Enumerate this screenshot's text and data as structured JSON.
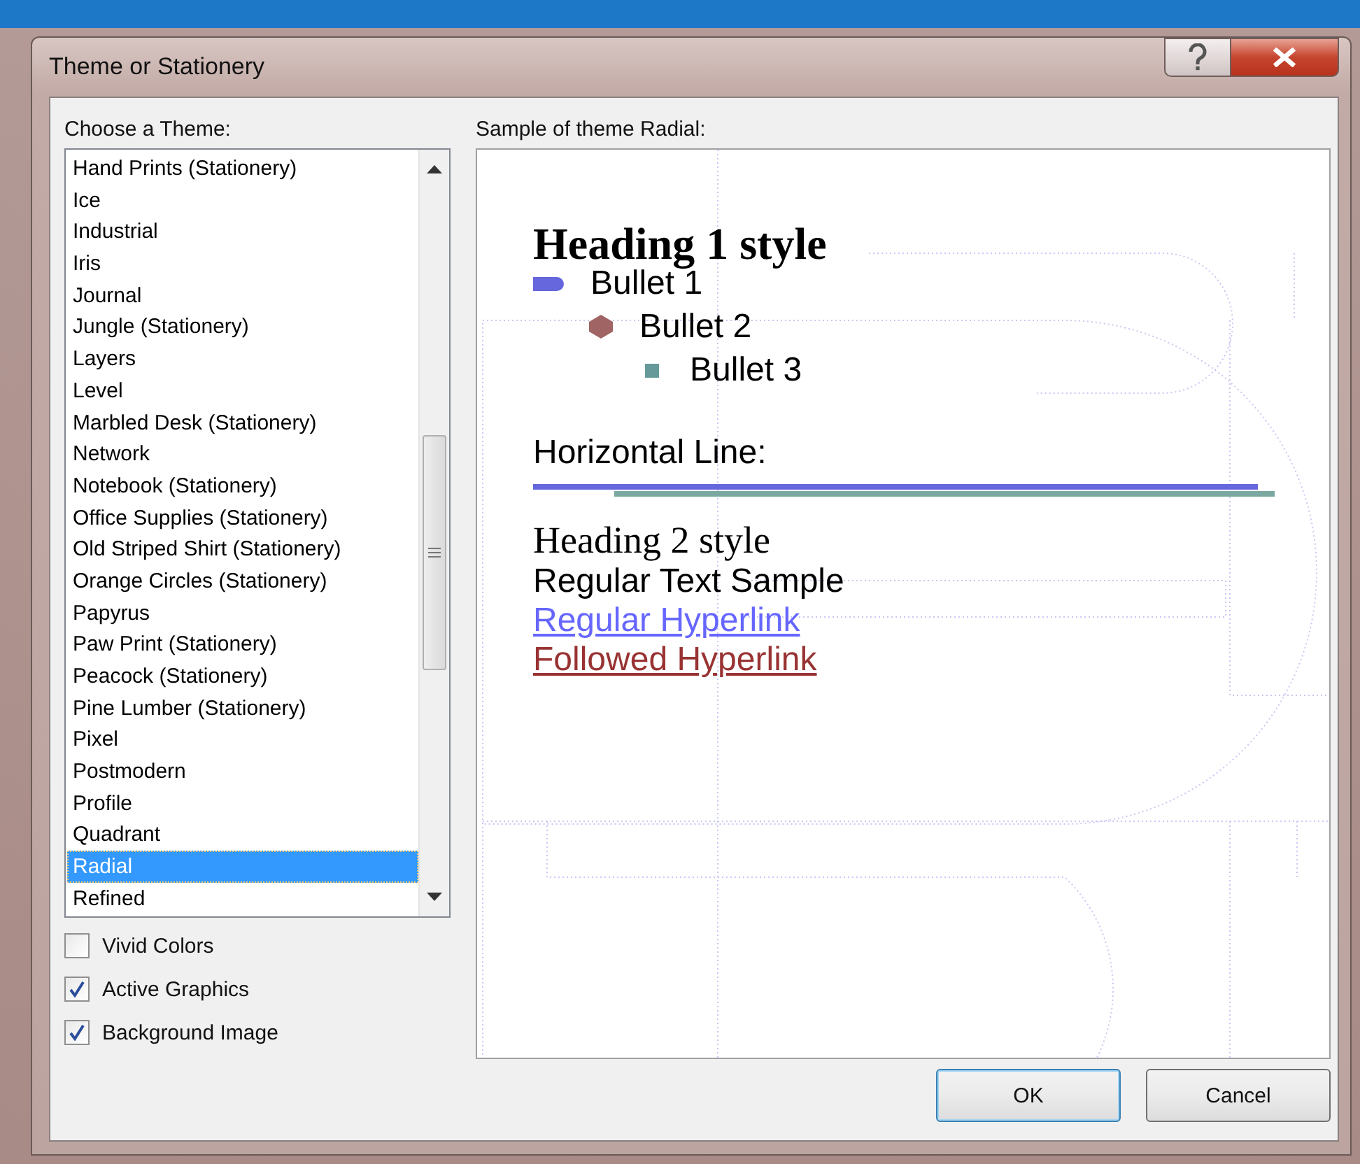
{
  "window": {
    "title": "Theme or Stationery"
  },
  "theme_list": {
    "label": "Choose a Theme:",
    "items": [
      {
        "label": "Hand Prints (Stationery)",
        "selected": false
      },
      {
        "label": "Ice",
        "selected": false
      },
      {
        "label": "Industrial",
        "selected": false
      },
      {
        "label": "Iris",
        "selected": false
      },
      {
        "label": "Journal",
        "selected": false
      },
      {
        "label": "Jungle (Stationery)",
        "selected": false
      },
      {
        "label": "Layers",
        "selected": false
      },
      {
        "label": "Level",
        "selected": false
      },
      {
        "label": "Marbled Desk (Stationery)",
        "selected": false
      },
      {
        "label": "Network",
        "selected": false
      },
      {
        "label": "Notebook (Stationery)",
        "selected": false
      },
      {
        "label": "Office Supplies (Stationery)",
        "selected": false
      },
      {
        "label": "Old Striped Shirt (Stationery)",
        "selected": false
      },
      {
        "label": "Orange Circles (Stationery)",
        "selected": false
      },
      {
        "label": "Papyrus",
        "selected": false
      },
      {
        "label": "Paw Print (Stationery)",
        "selected": false
      },
      {
        "label": "Peacock (Stationery)",
        "selected": false
      },
      {
        "label": "Pine Lumber (Stationery)",
        "selected": false
      },
      {
        "label": "Pixel",
        "selected": false
      },
      {
        "label": "Postmodern",
        "selected": false
      },
      {
        "label": "Profile",
        "selected": false
      },
      {
        "label": "Quadrant",
        "selected": false
      },
      {
        "label": "Radial",
        "selected": true
      },
      {
        "label": "Refined",
        "selected": false
      }
    ]
  },
  "options": [
    {
      "label": "Vivid Colors",
      "checked": false
    },
    {
      "label": "Active Graphics",
      "checked": true
    },
    {
      "label": "Background Image",
      "checked": true
    }
  ],
  "preview": {
    "label": "Sample of theme Radial:",
    "heading_1": "Heading 1 style",
    "bullets": [
      {
        "text": "Bullet 1",
        "children": [
          {
            "text": "Bullet 2",
            "children": [
              {
                "text": "Bullet 3"
              }
            ]
          }
        ]
      }
    ],
    "horizontal_line_label": "Horizontal Line:",
    "heading_2": "Heading 2 style",
    "regular_text": "Regular Text Sample",
    "hyperlink": "Regular Hyperlink",
    "followed_hyperlink": "Followed Hyperlink"
  },
  "buttons": [
    {
      "label": "OK",
      "default": true
    },
    {
      "label": "Cancel",
      "default": false
    }
  ]
}
